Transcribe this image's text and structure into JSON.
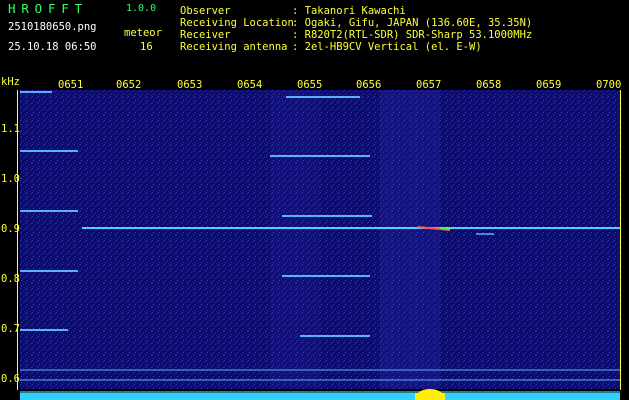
{
  "header": {
    "app_logo": "HROFFT",
    "version": "1.0.0",
    "filename": "2510180650.png",
    "type_label": "meteor",
    "datetime": "25.10.18 06:50",
    "count": "16",
    "observer_label": "Observer",
    "observer_value": ": Takanori Kawachi",
    "location_label": "Receiving Location",
    "location_value": ": Ogaki, Gifu, JAPAN (136.60E, 35.35N)",
    "receiver_label": "Receiver",
    "receiver_value": ": R820T2(RTL-SDR) SDR-Sharp 53.1000MHz",
    "antenna_label": "Receiving antenna",
    "antenna_value": ": 2el-HB9CV Vertical (el. E-W)"
  },
  "axis": {
    "unit": "kHz",
    "time_ticks": [
      "0651",
      "0652",
      "0653",
      "0654",
      "0655",
      "0656",
      "0657",
      "0658",
      "0659",
      "0700"
    ],
    "freq_ticks": [
      "1.1",
      "1.0",
      "0.9",
      "0.8",
      "0.7",
      "0.6"
    ]
  },
  "colors": {
    "background": "#0a0a6a",
    "text": "#ffff33",
    "logo": "#33ff66",
    "signal": "#4fd0ff"
  }
}
